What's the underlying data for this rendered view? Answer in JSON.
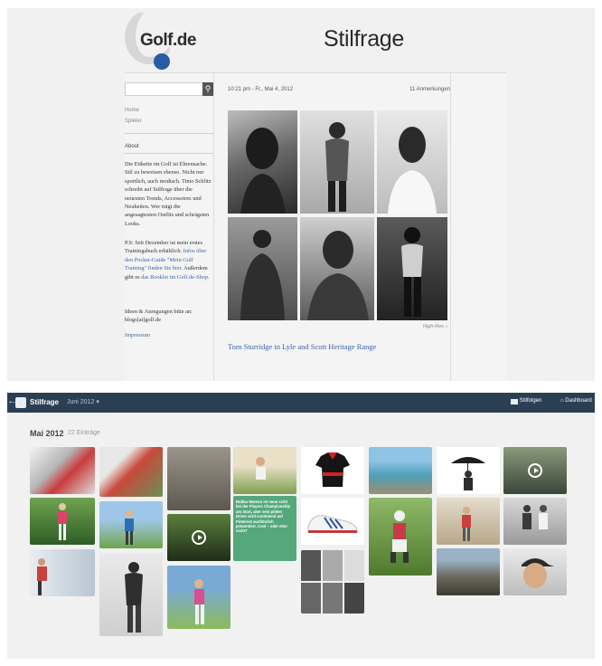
{
  "blog": {
    "logo_text": "Golf.de",
    "site_title": "Stilfrage",
    "nav": [
      "Home",
      "Spieler"
    ],
    "about_label": "About",
    "about_paragraphs": [
      "Die Etikette im Golf ist Ehrensache. Stil zu beweisen ebenso. Nicht nur sportlich, auch modisch. Timo Schlitz schreibt auf Stilfrage über die neuesten Trends, Accessoires und Neuheiten. Wer trägt die angesagtesten Outfits und schrägsten Looks."
    ],
    "training_pre": "P.S: Seit Dezember ist mein erstes Trainingsbuch erhältlich. ",
    "training_link": "Infos über den Pocket-Guide \"Mein Golf Training\" finden Sie hier.",
    "booklet_pre": " Außerdem gibt es ",
    "booklet_link": "das Booklet im Golf.de-Shop",
    "booklet_post": ".",
    "contact_text": "Ideen & Anregungen bitte an: blogs[at]golf.de",
    "impressum": "Impressum",
    "post_date": "10:21 pm - Fr., Mai 4, 2012",
    "post_notes": "11 Anmerkungen",
    "photo_caption": "High-Res",
    "post_title": "Tom Sturridge in Lyle and Scott Heritage Range"
  },
  "archive": {
    "topbar": {
      "blog_name": "Stilfrage",
      "month": "Juni 2012",
      "follow_label": "Stilfolgen",
      "dashboard_label": "Dashboard"
    },
    "month_heading": "Mai 2012",
    "entry_count": "22 Einträge",
    "text_post": "Bubba Watson ist neue sicht bei der Players Championship am Start, aber sein pinker Driver wird contintend auf Pinterest ausführlich präsentiert. Cool – oder eher nicht?",
    "text_post_link": "pinterest.com"
  },
  "colors": {
    "topbar": "#2b3f54",
    "link": "#3a66a8",
    "logo_dot": "#2a5aa3",
    "text_tile": "#54a87c"
  }
}
